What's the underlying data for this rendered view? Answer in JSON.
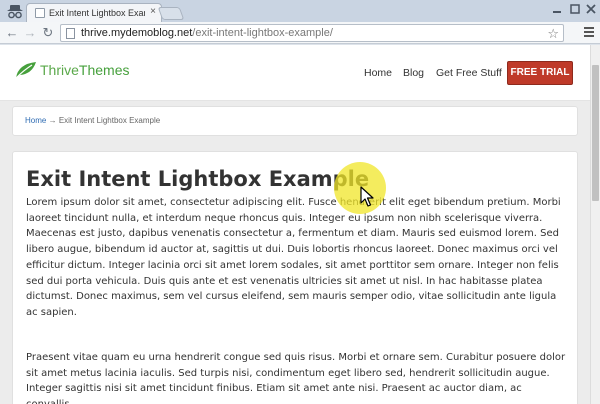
{
  "browser": {
    "tab_title": "Exit Intent Lightbox Examp",
    "tab_close": "×",
    "back": "←",
    "forward": "→",
    "reload": "↻",
    "url_host": "thrive.mydemoblog.net",
    "url_path": "/exit-intent-lightbox-example/",
    "bookmark_star": "☆"
  },
  "site": {
    "logo_part1": "Thrive",
    "logo_part2": "Themes",
    "brand_color": "#46a03c",
    "nav": {
      "home": "Home",
      "blog": "Blog",
      "get_free_stuff": "Get Free Stuff",
      "free_trial": "FREE TRIAL"
    },
    "cta_color": "#bf3a29"
  },
  "breadcrumb": {
    "home": "Home",
    "separator": "→",
    "current": "Exit Intent Lightbox Example"
  },
  "article": {
    "title": "Exit Intent Lightbox Example",
    "paragraph1": "Lorem ipsum dolor sit amet, consectetur adipiscing elit. Fusce hendrerit elit eget bibendum pretium. Morbi laoreet tincidunt nulla, et interdum neque rhoncus quis. Integer eu ipsum non nibh scelerisque viverra. Maecenas est justo, dapibus venenatis consectetur a, fermentum et diam. Mauris sed euismod lorem. Sed libero augue, bibendum id auctor at, sagittis ut dui. Duis lobortis rhoncus laoreet. Donec maximus orci vel efficitur dictum. Integer lacinia orci sit amet lorem sodales, sit amet porttitor sem ornare. Integer non felis sed dui porta vehicula. Duis quis ante et est venenatis ultricies sit amet ut nisl. In hac habitasse platea dictumst. Donec maximus, sem vel cursus eleifend, sem mauris semper odio, vitae sollicitudin ante ligula ac sapien.",
    "paragraph2": "Praesent vitae quam eu urna hendrerit congue sed quis risus. Morbi et ornare sem. Curabitur posuere dolor sit amet metus lacinia iaculis. Sed turpis nisi, condimentum eget libero sed, hendrerit sollicitudin augue. Integer sagittis nisi sit amet tincidunt finibus. Etiam sit amet ante nisi. Praesent ac auctor diam, ac convallis"
  },
  "icons": {
    "incognito": "incognito-icon",
    "favicon": "page-favicon-icon",
    "menu": "hamburger-menu-icon",
    "logo_leaf": "leaf-logo-icon",
    "cursor": "mouse-pointer-icon"
  },
  "highlight_color": "#f0e628"
}
